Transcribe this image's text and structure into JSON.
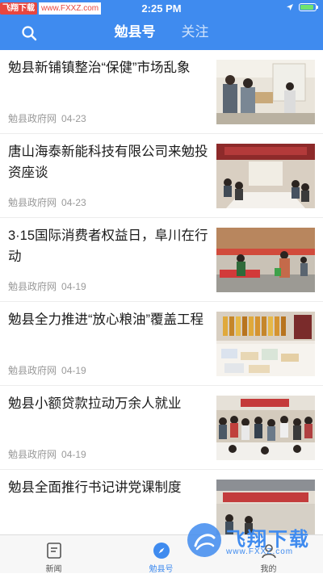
{
  "status_bar": {
    "watermark_tag": "飞翔下载",
    "watermark_url": "www.FXXZ.com",
    "time": "2:25 PM",
    "battery_level": 0.9
  },
  "nav": {
    "search_icon": "search-icon",
    "tabs": [
      {
        "label": "勉县号",
        "active": true
      },
      {
        "label": "关注",
        "active": false
      }
    ]
  },
  "news": [
    {
      "title": "勉县新铺镇整治“保健”市场乱象",
      "source": "勉县政府网",
      "date": "04-23"
    },
    {
      "title": "唐山海泰新能科技有限公司来勉投资座谈",
      "source": "勉县政府网",
      "date": "04-23"
    },
    {
      "title": "3·15国际消费者权益日，阜川在行动",
      "source": "勉县政府网",
      "date": "04-19"
    },
    {
      "title": "勉县全力推进“放心粮油”覆盖工程",
      "source": "勉县政府网",
      "date": "04-19"
    },
    {
      "title": "勉县小额贷款拉动万余人就业",
      "source": "勉县政府网",
      "date": "04-19"
    },
    {
      "title": "勉县全面推行书记讲党课制度",
      "source": "",
      "date": ""
    }
  ],
  "tabbar": {
    "items": [
      {
        "label": "新闻",
        "icon": "news-icon"
      },
      {
        "label": "勉县号",
        "icon": "compass-icon",
        "active": true
      },
      {
        "label": "我的",
        "icon": "profile-icon"
      }
    ]
  },
  "watermark": {
    "brand": "飞翔下载",
    "domain": "www.FXXZ.com"
  },
  "colors": {
    "primary": "#3f8bef",
    "divider": "#ececec",
    "meta_text": "#9a9a9a"
  }
}
